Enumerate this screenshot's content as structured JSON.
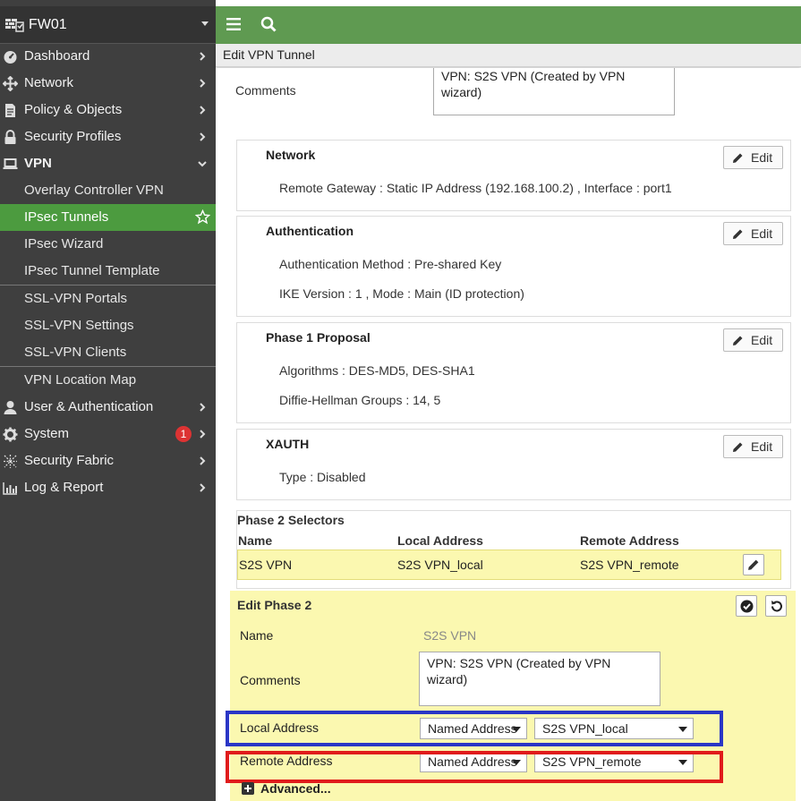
{
  "sidebar": {
    "device_name": "FW01",
    "items": [
      {
        "label": "Dashboard"
      },
      {
        "label": "Network"
      },
      {
        "label": "Policy & Objects"
      },
      {
        "label": "Security Profiles"
      },
      {
        "label": "VPN"
      },
      {
        "label": "User & Authentication"
      },
      {
        "label": "System"
      },
      {
        "label": "Security Fabric"
      },
      {
        "label": "Log & Report"
      }
    ],
    "vpn_sub": [
      {
        "label": "Overlay Controller VPN"
      },
      {
        "label": "IPsec Tunnels"
      },
      {
        "label": "IPsec Wizard"
      },
      {
        "label": "IPsec Tunnel Template"
      },
      {
        "label": "SSL-VPN Portals"
      },
      {
        "label": "SSL-VPN Settings"
      },
      {
        "label": "SSL-VPN Clients"
      },
      {
        "label": "VPN Location Map"
      }
    ],
    "system_badge": "1",
    "active_color": "#4c9b3f"
  },
  "topbar": {
    "color": "#5f9a51",
    "menu_icon": "hamburger-icon",
    "search_icon": "search-icon"
  },
  "breadcrumb": "Edit VPN Tunnel",
  "comments": {
    "label": "Comments",
    "value": "VPN: S2S VPN (Created by VPN wizard)"
  },
  "panels": {
    "network": {
      "title": "Network",
      "line1": "Remote Gateway : Static IP Address (192.168.100.2) , Interface : port1",
      "edit": "Edit"
    },
    "authentication": {
      "title": "Authentication",
      "line1": "Authentication Method : Pre-shared Key",
      "line2": "IKE Version : 1 , Mode : Main (ID protection)",
      "edit": "Edit"
    },
    "phase1": {
      "title": "Phase 1 Proposal",
      "line1": "Algorithms : DES-MD5, DES-SHA1",
      "line2": "Diffie-Hellman Groups : 14, 5",
      "edit": "Edit"
    },
    "xauth": {
      "title": "XAUTH",
      "line1": "Type : Disabled",
      "edit": "Edit"
    }
  },
  "phase2_selectors": {
    "title": "Phase 2 Selectors",
    "headers": {
      "name": "Name",
      "local": "Local Address",
      "remote": "Remote Address"
    },
    "row": {
      "name": "S2S VPN",
      "local": "S2S VPN_local",
      "remote": "S2S VPN_remote"
    }
  },
  "edit_phase2": {
    "title": "Edit Phase 2",
    "name_label": "Name",
    "name_value": "S2S VPN",
    "comments_label": "Comments",
    "comments_value": "VPN: S2S VPN (Created by VPN wizard)",
    "local_label": "Local Address",
    "local_type": "Named Address",
    "local_value": "S2S VPN_local",
    "remote_label": "Remote Address",
    "remote_type": "Named Address",
    "remote_value": "S2S VPN_remote",
    "advanced": "Advanced..."
  },
  "highlight_colors": {
    "blue": "#2a36c6",
    "red": "#e01b1b"
  }
}
